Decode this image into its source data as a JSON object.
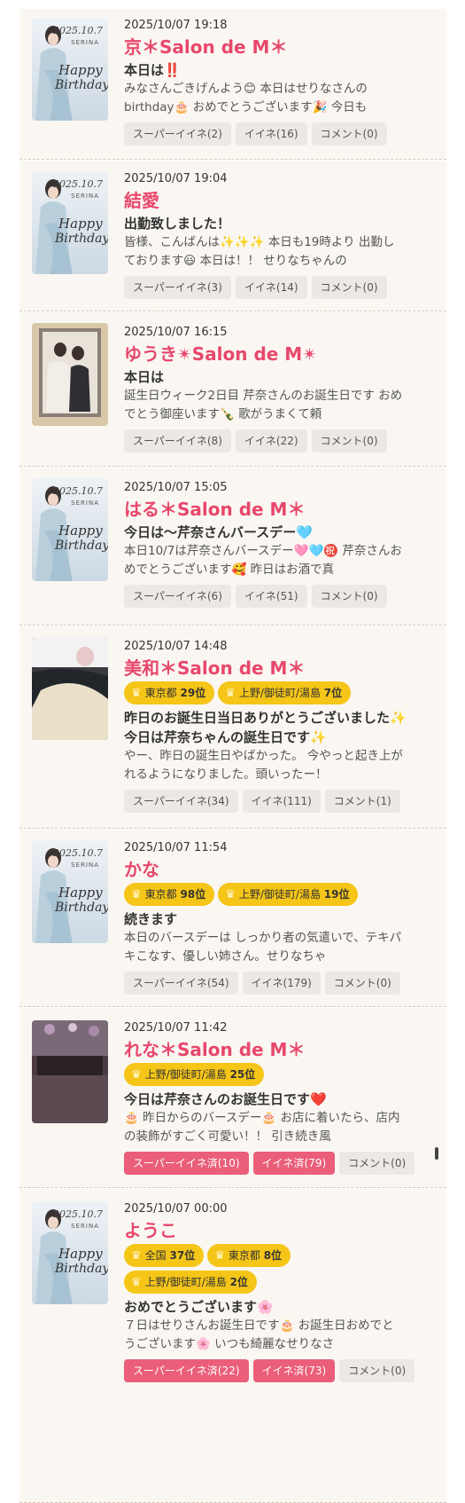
{
  "posts": [
    {
      "timestamp": "2025/10/07 19:18",
      "author": "京＊Salon de M＊",
      "thumb": "birthday",
      "badges": [],
      "title": [
        "本日は‼️"
      ],
      "excerpt": [
        "みなさんごきげんよう😊 本日はせりなさんの",
        "birthday🎂 おめでとうございます🎉 今日も"
      ],
      "actions": {
        "super": "スーパーイイネ(2)",
        "like": "イイネ(16)",
        "comment": "コメント(0)",
        "super_active": false,
        "like_active": false
      }
    },
    {
      "timestamp": "2025/10/07 19:04",
      "author": "結愛",
      "thumb": "birthday",
      "badges": [],
      "title": [
        "出勤致しました！"
      ],
      "excerpt": [
        " 皆様、こんばんは✨✨✨ 本日も19時より 出勤し",
        "ております😃 本日は！！ せりなちゃんの"
      ],
      "actions": {
        "super": "スーパーイイネ(3)",
        "like": "イイネ(14)",
        "comment": "コメント(0)",
        "super_active": false,
        "like_active": false
      }
    },
    {
      "timestamp": "2025/10/07 16:15",
      "author": "ゆうき✴Salon de M✴",
      "thumb": "photo",
      "badges": [],
      "title": [
        "本日は"
      ],
      "excerpt": [
        "誕生日ウィーク2日目 芹奈さんのお誕生日です おめ",
        "でとう御座います🍾 歌がうまくて頼"
      ],
      "actions": {
        "super": "スーパーイイネ(8)",
        "like": "イイネ(22)",
        "comment": "コメント(0)",
        "super_active": false,
        "like_active": false
      }
    },
    {
      "timestamp": "2025/10/07 15:05",
      "author": "はる＊Salon de M＊",
      "thumb": "birthday",
      "badges": [],
      "title": [
        "今日は〜芹奈さんバースデー🩵"
      ],
      "excerpt": [
        "本日10/7は芹奈さんバースデー🩷🩵㊗️ 芹奈さんお",
        "めでとうございます🥰 昨日はお酒で真"
      ],
      "actions": {
        "super": "スーパーイイネ(6)",
        "like": "イイネ(51)",
        "comment": "コメント(0)",
        "super_active": false,
        "like_active": false
      }
    },
    {
      "timestamp": "2025/10/07 14:48",
      "author": "美和＊Salon de M＊",
      "thumb": "dark",
      "badges": [
        {
          "area": "東京都",
          "rank": "29位"
        },
        {
          "area": "上野/御徒町/湯島",
          "rank": "7位"
        }
      ],
      "title": [
        "昨日のお誕生日当日ありがとうございました✨",
        "今日は芹奈ちゃんの誕生日です✨"
      ],
      "excerpt": [
        "やー、昨日の誕生日やばかった。 今やっと起き上が",
        "れるようになりました。頭いったー！"
      ],
      "actions": {
        "super": "スーパーイイネ(34)",
        "like": "イイネ(111)",
        "comment": "コメント(1)",
        "super_active": false,
        "like_active": false
      }
    },
    {
      "timestamp": "2025/10/07 11:54",
      "author": "かな",
      "thumb": "birthday",
      "badges": [
        {
          "area": "東京都",
          "rank": "98位"
        },
        {
          "area": "上野/御徒町/湯島",
          "rank": "19位"
        }
      ],
      "title": [
        "続きます"
      ],
      "excerpt": [
        "本日のバースデーは しっかり者の気遣いで、テキパ",
        "キこなす、優しい姉さん。せりなちゃ"
      ],
      "actions": {
        "super": "スーパーイイネ(54)",
        "like": "イイネ(179)",
        "comment": "コメント(0)",
        "super_active": false,
        "like_active": false
      }
    },
    {
      "timestamp": "2025/10/07 11:42",
      "author": "れな＊Salon de M＊",
      "thumb": "room",
      "badges": [
        {
          "area": "上野/御徒町/湯島",
          "rank": "25位"
        }
      ],
      "title": [
        "今日は芹奈さんのお誕生日です❤️"
      ],
      "excerpt": [
        "🎂 昨日からのバースデー🎂 お店に着いたら、店内",
        "の装飾がすごく可愛い！！ 引き続き風"
      ],
      "actions": {
        "super": "スーパーイイネ済(10)",
        "like": "イイネ済(79)",
        "comment": "コメント(0)",
        "super_active": true,
        "like_active": true
      }
    },
    {
      "timestamp": "2025/10/07 00:00",
      "author": "ようこ",
      "thumb": "birthday",
      "badges": [
        {
          "area": "全国",
          "rank": "37位"
        },
        {
          "area": "東京都",
          "rank": "8位"
        },
        {
          "area": "上野/御徒町/湯島",
          "rank": "2位"
        }
      ],
      "title": [
        "おめでとうございます🌸"
      ],
      "excerpt": [
        "７日はせりさんお誕生日です🎂 お誕生日おめでと",
        "うございます🌸 いつも綺麗なせりなさ"
      ],
      "actions": {
        "super": "スーパーイイネ済(22)",
        "like": "イイネ済(73)",
        "comment": "コメント(0)",
        "super_active": true,
        "like_active": true
      }
    }
  ],
  "thumb_text": {
    "date": "2025.10.7",
    "name": "SERINA",
    "line1": "Happy",
    "line2": "Birthday"
  },
  "crown_glyph": "♛",
  "colors": {
    "author": "#e8476b",
    "badge": "#f5c518",
    "active_button": "#ea5e7a"
  }
}
